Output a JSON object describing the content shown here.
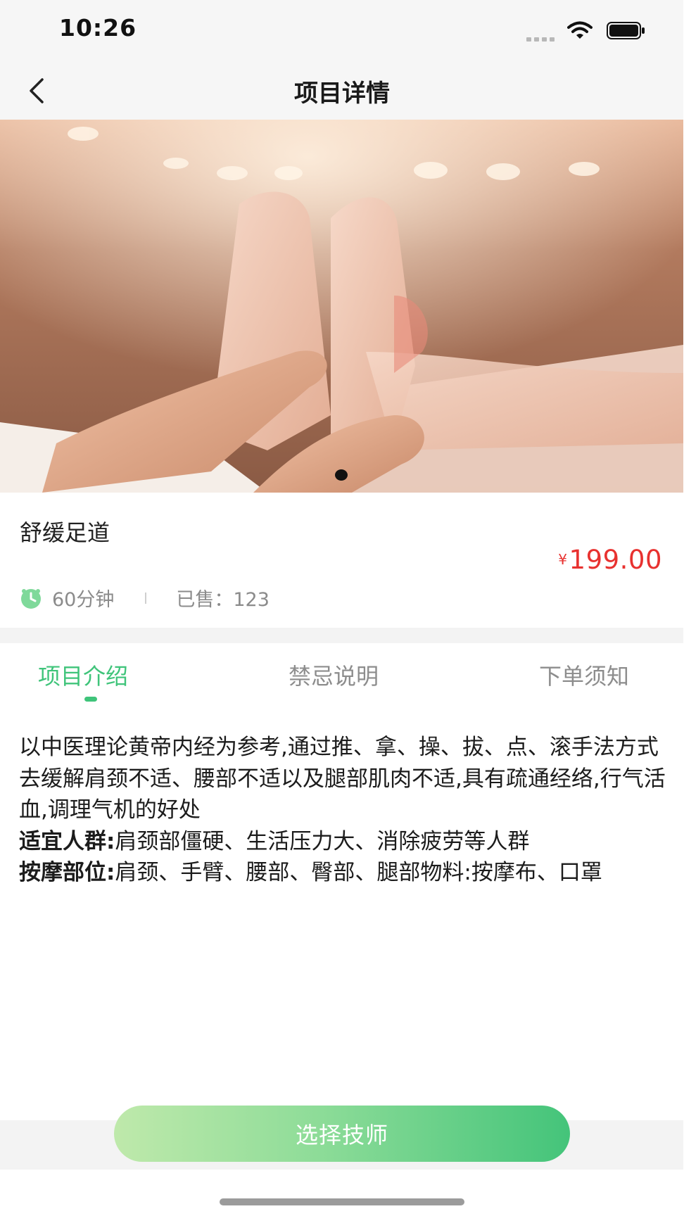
{
  "status_bar": {
    "time": "10:26"
  },
  "nav": {
    "title": "项目详情"
  },
  "hero": {
    "dots": 1,
    "active_dot": 1
  },
  "service": {
    "name": "舒缓足道",
    "price_currency": "¥",
    "price": "199.00",
    "duration": "60分钟",
    "sold_label": "已售：123"
  },
  "tabs": [
    {
      "label": "项目介绍",
      "active": true
    },
    {
      "label": "禁忌说明",
      "active": false
    },
    {
      "label": "下单须知",
      "active": false
    }
  ],
  "description": {
    "intro": "以中医理论黄帝内经为参考,通过推、拿、操、拔、点、滚手法方式去缓解肩颈不适、腰部不适以及腿部肌肉不适,具有疏通经络,行气活血,调理气机的好处",
    "suitable_label": "适宜人群:",
    "suitable_text": "肩颈部僵硬、生活压力大、消除疲劳等人群",
    "area_label": "按摩部位:",
    "area_text": "肩颈、手臂、腰部、臀部、腿部物料:按摩布、口罩"
  },
  "cta": {
    "label": "选择技师"
  },
  "colors": {
    "accent": "#3fc47a",
    "price": "#e8312f"
  },
  "icons": [
    "back-chevron-icon",
    "signal-icon",
    "wifi-icon",
    "battery-icon",
    "clock-icon"
  ]
}
